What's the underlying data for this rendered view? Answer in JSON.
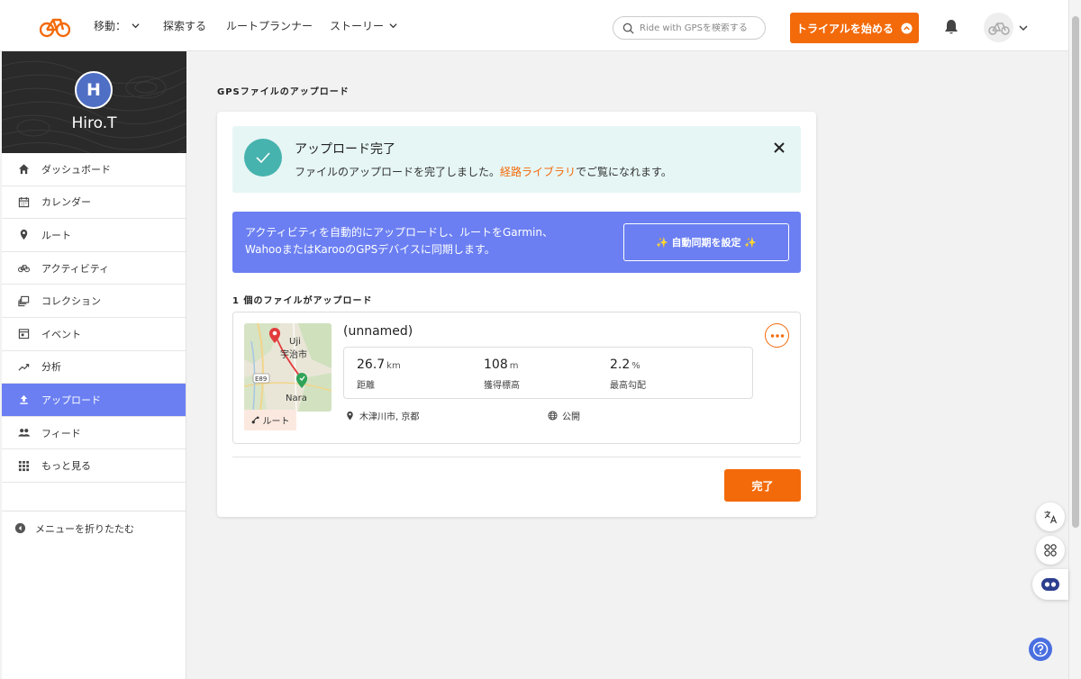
{
  "header": {
    "nav": [
      {
        "label": "移動：",
        "has_dropdown": true
      },
      {
        "label": "探索する",
        "has_dropdown": false
      },
      {
        "label": "ルートプランナー",
        "has_dropdown": false
      },
      {
        "label": "ストーリー",
        "has_dropdown": true
      }
    ],
    "search_placeholder": "Ride with GPSを検索する",
    "trial_label": "トライアルを始める"
  },
  "sidebar": {
    "user_initial": "H",
    "user_name": "Hiro.T",
    "items": [
      {
        "label": "ダッシュボード",
        "icon": "home-icon"
      },
      {
        "label": "カレンダー",
        "icon": "calendar-icon"
      },
      {
        "label": "ルート",
        "icon": "map-pin-icon"
      },
      {
        "label": "アクティビティ",
        "icon": "bike-icon"
      },
      {
        "label": "コレクション",
        "icon": "collection-icon"
      },
      {
        "label": "イベント",
        "icon": "event-icon"
      },
      {
        "label": "分析",
        "icon": "trend-icon"
      },
      {
        "label": "アップロード",
        "icon": "upload-icon",
        "active": true
      },
      {
        "label": "フィード",
        "icon": "people-icon"
      },
      {
        "label": "もっと見る",
        "icon": "grid-icon"
      }
    ],
    "collapse_label": "メニューを折りたたむ"
  },
  "main": {
    "title": "GPSファイルのアップロード",
    "success": {
      "title": "アップロード完了",
      "message_before": "ファイルのアップロードを完了しました。",
      "link": "経路ライブラリ",
      "message_after": "でご覧になれます。"
    },
    "promo": {
      "text_line1": "アクティビティを自動的にアップロードし、ルートをGarmin、",
      "text_line2": "WahooまたはKarooのGPSデバイスに同期します。",
      "button": "✨ 自動同期を設定 ✨"
    },
    "files_count": "1 個のファイルがアップロード",
    "file": {
      "name": "(unnamed)",
      "type_tag": "ルート",
      "map_labels": {
        "uji": "Uji",
        "uji_jp": "宇治市",
        "nara": "Nara",
        "road": "E89"
      },
      "stats": [
        {
          "value": "26.7",
          "unit": "km",
          "label": "距離"
        },
        {
          "value": "108",
          "unit": "m",
          "label": "獲得標高"
        },
        {
          "value": "2.2",
          "unit": "%",
          "label": "最高勾配"
        }
      ],
      "location": "木津川市, 京都",
      "visibility": "公開"
    },
    "done_button": "完了"
  },
  "colors": {
    "accent": "#f36a0a",
    "active_nav": "#6b7ff2",
    "success_bg": "#e6f6f5",
    "success_icon": "#47b3ae"
  }
}
